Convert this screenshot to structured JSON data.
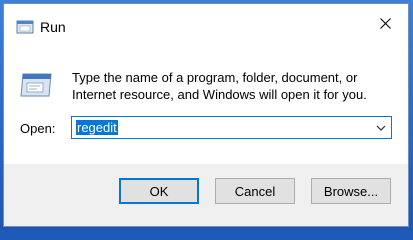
{
  "window": {
    "title": "Run",
    "title_icon": "run-icon",
    "close_icon": "close-icon"
  },
  "content": {
    "description": "Type the name of a program, folder, document, or Internet resource, and Windows will open it for you.",
    "icon": "run-icon",
    "open_label": "Open:",
    "open_value": "regedit",
    "dropdown_icon": "chevron-down-icon"
  },
  "buttons": {
    "ok": "OK",
    "cancel": "Cancel",
    "browse": "Browse..."
  },
  "colors": {
    "accent": "#0078d7",
    "dialog_bg": "#f0f0f0",
    "content_bg": "#ffffff"
  }
}
